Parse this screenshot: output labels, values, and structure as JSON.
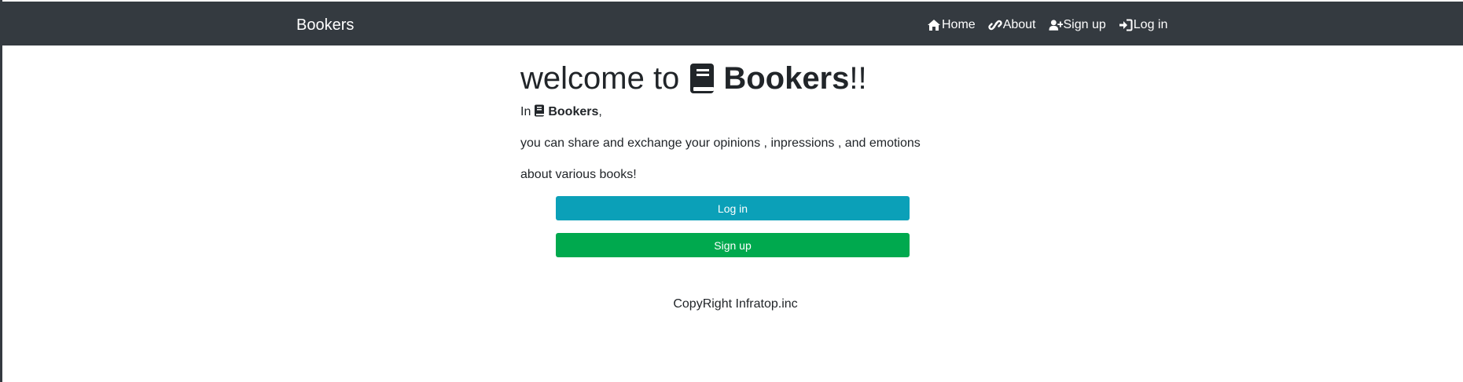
{
  "navbar": {
    "brand": "Bookers",
    "links": [
      {
        "label": "Home",
        "icon": "home-icon"
      },
      {
        "label": "About",
        "icon": "link-icon"
      },
      {
        "label": "Sign up",
        "icon": "user-plus-icon"
      },
      {
        "label": "Log in",
        "icon": "sign-in-icon"
      }
    ]
  },
  "hero": {
    "prefix": "welcome to",
    "brand": "Bookers",
    "suffix": "!!"
  },
  "intro": {
    "line1_prefix": "In",
    "line1_brand": "Bookers",
    "line1_suffix": ",",
    "line2": "you can share and exchange your opinions , inpressions , and emotions",
    "line3": "about various books!"
  },
  "buttons": {
    "login": "Log in",
    "signup": "Sign up"
  },
  "footer": {
    "copyright": "CopyRight Infratop.inc"
  },
  "colors": {
    "navbar": "#343a40",
    "login_button": "#0ba0b8",
    "signup_button": "#00a94e"
  }
}
